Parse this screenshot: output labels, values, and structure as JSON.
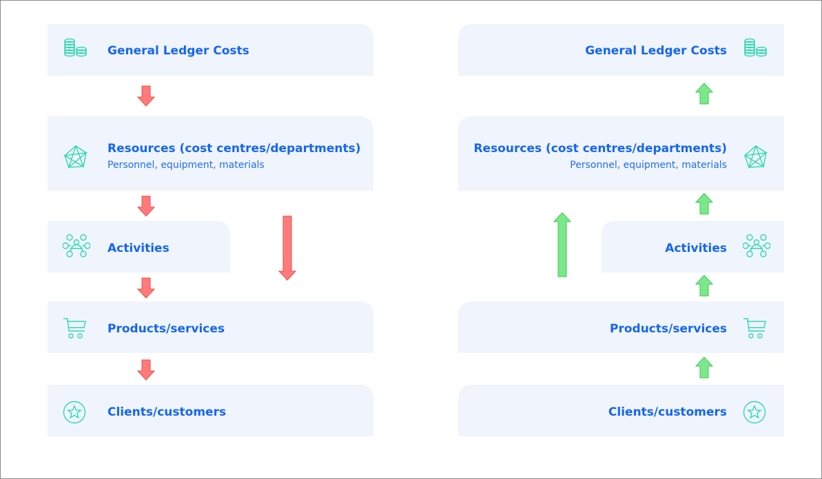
{
  "left_flow": {
    "direction": "down",
    "arrow_color": "#ff7b7b",
    "items": [
      {
        "title": "General Ledger Costs",
        "icon": "coins-stack-icon"
      },
      {
        "title": "Resources (cost centres/departments)",
        "subtitle": "Personnel, equipment, materials",
        "icon": "polygon-network-icon"
      },
      {
        "title": "Activities",
        "icon": "people-network-icon"
      },
      {
        "title": "Products/services",
        "icon": "shopping-cart-icon"
      },
      {
        "title": "Clients/customers",
        "icon": "star-circle-icon"
      }
    ]
  },
  "right_flow": {
    "direction": "up",
    "arrow_color": "#7ce88c",
    "items": [
      {
        "title": "General Ledger Costs",
        "icon": "coins-stack-icon"
      },
      {
        "title": "Resources (cost centres/departments)",
        "subtitle": "Personnel, equipment, materials",
        "icon": "polygon-network-icon"
      },
      {
        "title": "Activities",
        "icon": "people-network-icon"
      },
      {
        "title": "Products/services",
        "icon": "shopping-cart-icon"
      },
      {
        "title": "Clients/customers",
        "icon": "star-circle-icon"
      }
    ]
  },
  "colors": {
    "box_bg": "#f0f4fc",
    "text": "#1466f0",
    "icon": "#2ed8b0"
  }
}
